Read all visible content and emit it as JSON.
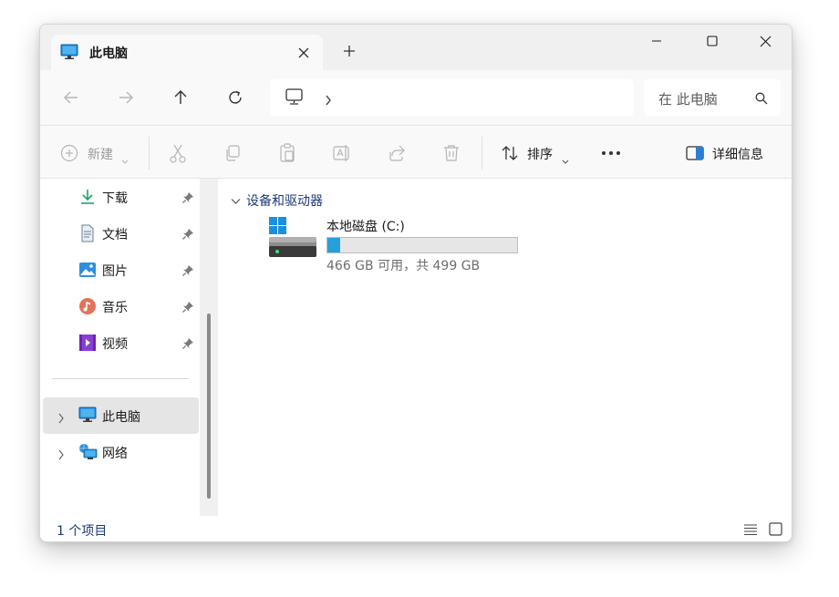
{
  "tab": {
    "title": "此电脑"
  },
  "search": {
    "placeholder": "在 此电脑"
  },
  "commands": {
    "new_label": "新建",
    "sort_label": "排序",
    "details_label": "详细信息"
  },
  "sidebar": {
    "quick_access": [
      {
        "label": "下载",
        "icon": "download-icon"
      },
      {
        "label": "文档",
        "icon": "document-icon"
      },
      {
        "label": "图片",
        "icon": "pictures-icon"
      },
      {
        "label": "音乐",
        "icon": "music-icon"
      },
      {
        "label": "视频",
        "icon": "video-icon"
      }
    ],
    "tree": [
      {
        "label": "此电脑",
        "icon": "this-pc-icon",
        "selected": true
      },
      {
        "label": "网络",
        "icon": "network-icon",
        "selected": false
      }
    ]
  },
  "content": {
    "group_label": "设备和驱动器",
    "drives": [
      {
        "name": "本地磁盘 (C:)",
        "size_text": "466 GB 可用，共 499 GB",
        "used_fraction": 0.066
      }
    ]
  },
  "status": {
    "count": "1 个项目"
  },
  "colors": {
    "accent": "#26a0da",
    "link_blue": "#1c3a78",
    "selected_bg": "#e5e5e5"
  }
}
